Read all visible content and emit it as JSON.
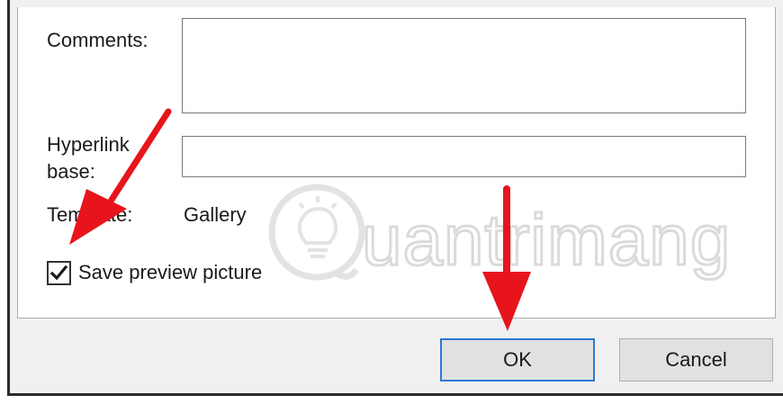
{
  "fields": {
    "comments": {
      "label": "Comments:",
      "value": ""
    },
    "hyperlink_base": {
      "label_line1": "Hyperlink",
      "label_line2": "base:",
      "value": ""
    },
    "template": {
      "label": "Template:",
      "value": "Gallery"
    }
  },
  "save_preview": {
    "label": "Save preview picture",
    "checked": true
  },
  "buttons": {
    "ok": "OK",
    "cancel": "Cancel"
  },
  "watermark": {
    "text": "uantrimang"
  },
  "colors": {
    "arrow": "#e8141b",
    "default_button_border": "#2f78d4",
    "dialog_bg": "#f0f0f0"
  }
}
